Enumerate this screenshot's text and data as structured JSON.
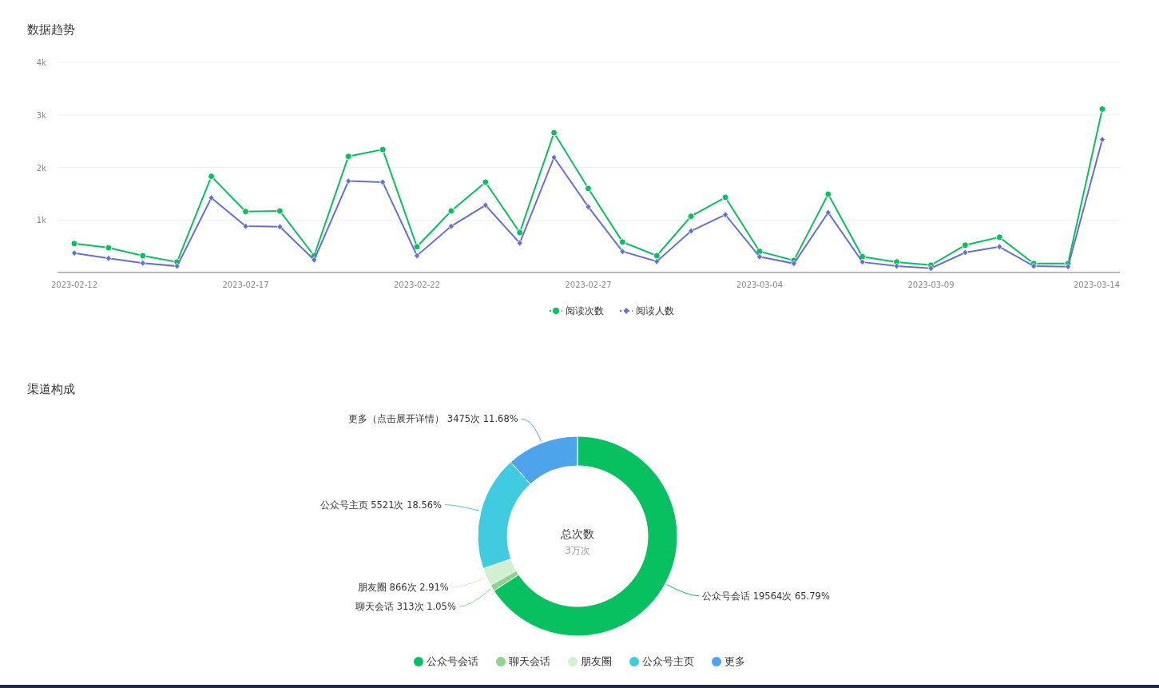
{
  "trend": {
    "title": "数据趋势",
    "chart_data": {
      "type": "line",
      "categories": [
        "2023-02-12",
        null,
        null,
        null,
        null,
        "2023-02-17",
        null,
        null,
        null,
        null,
        "2023-02-22",
        null,
        null,
        null,
        null,
        "2023-02-27",
        null,
        null,
        null,
        null,
        "2023-03-04",
        null,
        null,
        null,
        null,
        "2023-03-09",
        null,
        null,
        null,
        null,
        "2023-03-14"
      ],
      "grid": true,
      "ylim": [
        0,
        4000
      ],
      "yticks": [
        {
          "value": 1000,
          "label": "1k"
        },
        {
          "value": 2000,
          "label": "2k"
        },
        {
          "value": 3000,
          "label": "3k"
        },
        {
          "value": 4000,
          "label": "4k"
        }
      ],
      "series": [
        {
          "name": "阅读次数",
          "color": "#07c160",
          "marker": "circle",
          "values": [
            550,
            470,
            320,
            200,
            1830,
            1160,
            1170,
            320,
            2210,
            2340,
            490,
            1170,
            1720,
            760,
            2660,
            1600,
            580,
            320,
            1070,
            1430,
            400,
            230,
            1490,
            300,
            200,
            140,
            520,
            670,
            170,
            170,
            3110
          ]
        },
        {
          "name": "阅读人数",
          "color": "#6470d4",
          "marker": "diamond",
          "values": [
            370,
            270,
            180,
            120,
            1420,
            880,
            870,
            240,
            1740,
            1720,
            320,
            880,
            1280,
            560,
            2190,
            1250,
            400,
            210,
            790,
            1100,
            300,
            170,
            1140,
            200,
            120,
            80,
            380,
            490,
            120,
            110,
            2530
          ]
        }
      ]
    }
  },
  "channels": {
    "title": "渠道构成",
    "center_title": "总次数",
    "center_value": "3万次",
    "chart_data": {
      "type": "donut",
      "categories": [
        "公众号会话",
        "聊天会话",
        "朋友圈",
        "公众号主页",
        "更多"
      ],
      "values": [
        19564,
        313,
        866,
        5521,
        3475
      ],
      "colors": [
        "#07c160",
        "#8fd48e",
        "#d1f0d0",
        "#40cbe0",
        "#4ea4ea"
      ],
      "value_labels": [
        "公众号会话 19564次 65.79%",
        "聊天会话 313次 1.05%",
        "朋友圈 866次 2.91%",
        "公众号主页 5521次 18.56%",
        "更多（点击展开详情） 3475次 11.68%"
      ]
    }
  }
}
